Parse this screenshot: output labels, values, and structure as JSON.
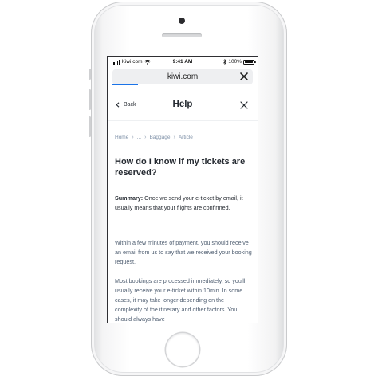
{
  "status_bar": {
    "carrier": "Kiwi.com",
    "time": "9:41 AM",
    "battery": "100%"
  },
  "browser": {
    "url": "kiwi.com",
    "close_icon": "close-icon",
    "load_progress": 0.18
  },
  "header": {
    "back_label": "Back",
    "title": "Help",
    "close_icon": "close-icon"
  },
  "breadcrumb": {
    "items": [
      "Home",
      "...",
      "Baggage",
      "Article"
    ],
    "separator_icon": "chevron-right-icon"
  },
  "article": {
    "title": "How do I know if my tickets are reserved?",
    "summary_label": "Summary:",
    "summary_text": " Once we send your e-ticket by email, it usually means that your flights are confirmed.",
    "paragraphs": [
      "Within a few minutes of payment, you should receive an email from us to say that we received your booking request.",
      "Most bookings are processed immediately, so you'll usually receive your e-ticket within 10min. In some cases, it may take longer depending on the complexity of the itinerary and other factors. You should always have"
    ]
  },
  "colors": {
    "accent": "#1a73e8",
    "text_primary": "#252a31",
    "text_secondary": "#4f5e71",
    "breadcrumb": "#7f91a8"
  }
}
